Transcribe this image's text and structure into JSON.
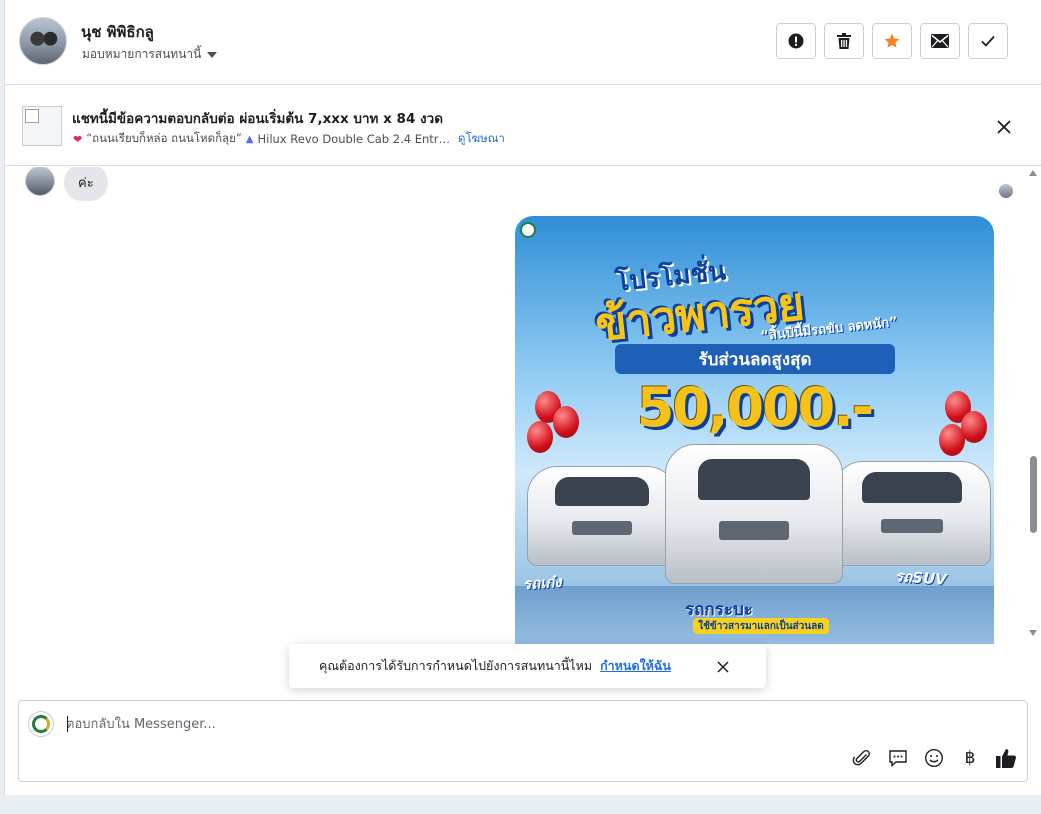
{
  "header": {
    "contact_name": "นุช พิพิธิกลู",
    "assign_label": "มอบหมายการสนทนานี้",
    "actions": [
      {
        "icon": "alert-icon"
      },
      {
        "icon": "trash-icon"
      },
      {
        "icon": "star-icon",
        "color": "#f5831f"
      },
      {
        "icon": "mail-icon"
      },
      {
        "icon": "check-icon"
      }
    ]
  },
  "ad": {
    "title": "แชทนี้มีข้อความตอบกลับต่อ ผ่อนเริ่มต้น 7,xxx บาท x 84 งวด",
    "subtitle_quote": "“ถนนเรียบก็หล่อ ถนนโหดก็ลุย”",
    "subtitle_car": "Hilux Revo Double Cab 2.4 Entr…",
    "view_ad": "ดูโฆษณา"
  },
  "messages": {
    "incoming_text": "ค่ะ",
    "promo": {
      "headline_top": "โปรโมชั่น",
      "headline_main": "ข้าวพารวย",
      "tagline": "“สิ้นปีนี้มีรถขับ ลดหนัก”",
      "band": "รับส่วนลดสูงสุด",
      "amount": "50,000.-",
      "label_left": "รถเก๋ง",
      "label_right": "รถSUV",
      "label_center": "รถกระบะ",
      "yellow_band": "ใช้ข้าวสารมาแลกเป็นส่วนลด"
    }
  },
  "toast": {
    "text": "คุณต้องการได้รับการกำหนดไปยังการสนทนานี้ไหม",
    "link": "กำหนดให้ฉัน"
  },
  "composer": {
    "placeholder": "ตอบกลับใน Messenger...",
    "tools": [
      "paperclip-icon",
      "saved-reply-icon",
      "emoji-icon",
      "baht-icon",
      "thumbs-up-icon"
    ],
    "baht_symbol": "฿"
  },
  "colors": {
    "accent": "#216fdb",
    "star": "#f5831f",
    "bubble": "#e4e6eb"
  }
}
